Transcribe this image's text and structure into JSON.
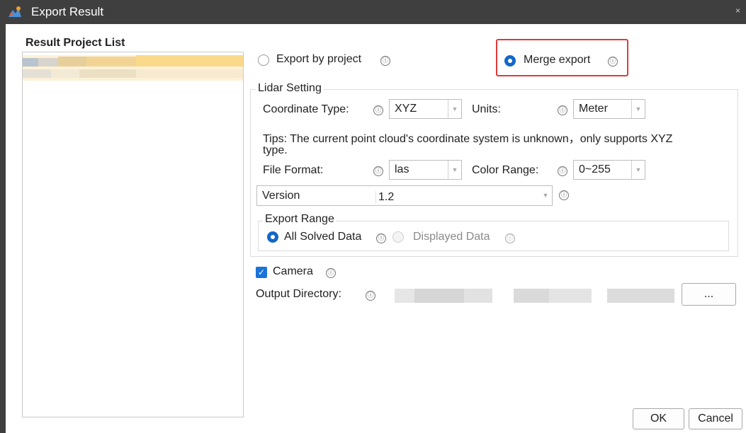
{
  "window": {
    "title": "Export Result",
    "close_glyph": "×"
  },
  "project_list": {
    "title": "Result Project List",
    "items": [
      {
        "label": ""
      }
    ]
  },
  "export_mode": {
    "by_project_label": "Export by project",
    "merge_label": "Merge export",
    "selected": "Merge export"
  },
  "lidar": {
    "group_title": "Lidar Setting",
    "coord_type_label": "Coordinate Type:",
    "coord_type_value": "XYZ",
    "units_label": "Units:",
    "units_value": "Meter",
    "tip_line1": "Tips: The current point cloud's coordinate system is unknown，only supports XYZ",
    "tip_line2": "type.",
    "file_format_label": "File Format:",
    "file_format_value": "las",
    "color_range_label": "Color Range:",
    "color_range_value": "0~255",
    "version_label": "Version",
    "version_value": "1.2",
    "export_range": {
      "group_title": "Export Range",
      "all_solved_label": "All Solved Data",
      "displayed_label": "Displayed Data",
      "selected": "All Solved Data"
    }
  },
  "camera": {
    "label": "Camera",
    "checked": true,
    "check_glyph": "✓"
  },
  "output": {
    "label": "Output Directory:",
    "value": "",
    "browse_label": "..."
  },
  "footer": {
    "ok_label": "OK",
    "cancel_label": "Cancel"
  },
  "icons": {
    "info": "ⓘ",
    "dropdown": "▼"
  },
  "colors": {
    "accent": "#1466c9",
    "highlight_box": "#e03a3a",
    "titlebar": "#3f3f3f"
  }
}
